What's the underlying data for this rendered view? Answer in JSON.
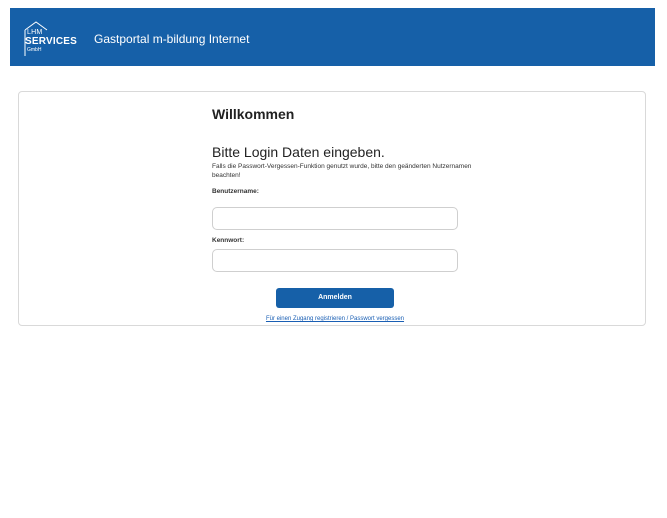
{
  "header": {
    "logo": {
      "line1": "LHM",
      "line2": "SERVICES",
      "line3": "GmbH"
    },
    "title": "Gastportal m-bildung Internet"
  },
  "login": {
    "welcome": "Willkommen",
    "subtitle": "Bitte Login Daten eingeben.",
    "hint": "Falls die Passwort-Vergessen-Funktion genutzt wurde, bitte den geänderten Nutzernamen beachten!",
    "username_label": "Benutzername:",
    "username_value": "",
    "password_label": "Kennwort:",
    "password_value": "",
    "submit_label": "Anmelden",
    "register_link": "Für einen Zugang registrieren / Passwort vergessen"
  },
  "colors": {
    "brand": "#1660a8",
    "link": "#1a5fb4"
  }
}
